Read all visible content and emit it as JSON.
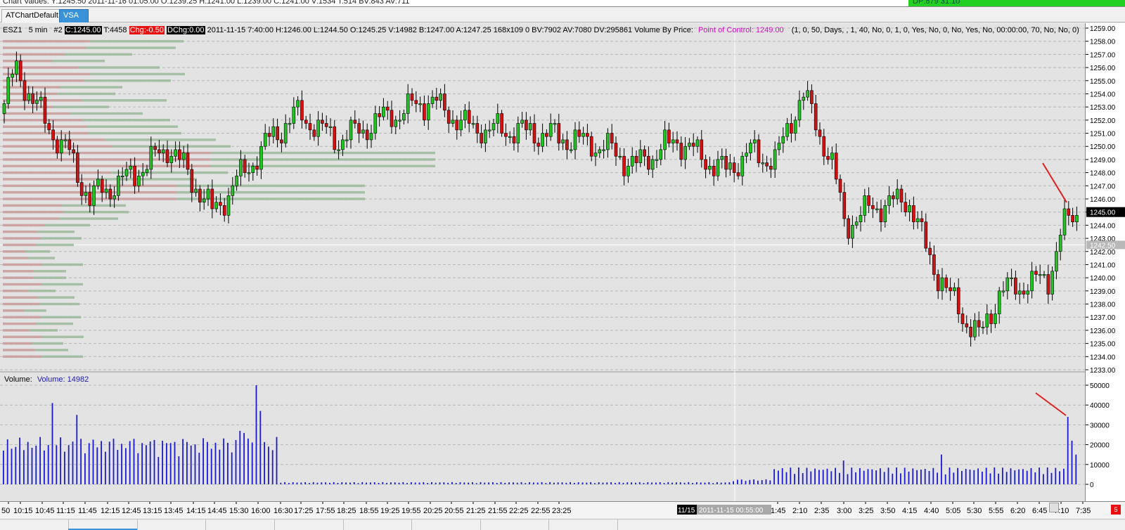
{
  "top_bar": {
    "chart_values": "Chart Values: Y:1245.50  2011-11-16  01:05:00  O:1239.25  H:1241.00  L:1239.00  C:1241.00  V:1534  T:514  BV:843  AV:711",
    "right_text": "DP:879  31:10",
    "right_color": "#22d022"
  },
  "tabs": [
    {
      "label": "ATChartDefault",
      "active": false
    },
    {
      "label": "VSA",
      "active": true
    }
  ],
  "info": {
    "symbol": "ESZ1",
    "interval": "5 min",
    "chart_num": "#2",
    "close": "C:1245.00",
    "ticks": "T:4458",
    "chg": "Chg:-0.50",
    "dchg": "DChg:0.00",
    "bar_stats": "2011-11-15 7:40:00 H:1246.00 L:1244.50 O:1245.25 V:14982 B:1247.00 A:1247.25 168x109 0 BV:7902 AV:7080 DV:295861 Volume By Price:",
    "poc": "Point of Control: 1249.00",
    "params": "(1, 0, 50, Days, , 1, 40, No, 0, 1, 0, Yes, No, 0, No, Yes, No, 00:00:00, 70, No, No, 0)"
  },
  "volume_panel": {
    "label": "Volume:",
    "value_label": "Volume: 14982"
  },
  "price_axis": {
    "ticks": [
      "1259.00",
      "1258.00",
      "1257.00",
      "1256.00",
      "1255.00",
      "1254.00",
      "1253.00",
      "1252.00",
      "1251.00",
      "1250.00",
      "1249.00",
      "1248.00",
      "1247.00",
      "1246.00",
      "1245.00",
      "1244.00",
      "1243.00",
      "1242.00",
      "1241.00",
      "1240.00",
      "1239.00",
      "1238.00",
      "1237.00",
      "1236.00",
      "1235.00",
      "1234.00",
      "1233.00"
    ],
    "last_price": "1245.00",
    "crosshair_price": "1242.50"
  },
  "volume_axis": {
    "ticks": [
      "50000",
      "40000",
      "30000",
      "20000",
      "10000",
      "0"
    ]
  },
  "time_axis": {
    "labels": [
      "50",
      "10:15",
      "10:45",
      "11:15",
      "11:45",
      "12:15",
      "12:45",
      "13:15",
      "13:45",
      "14:15",
      "14:45",
      "15:30",
      "16:00",
      "16:30",
      "17:25",
      "17:55",
      "18:25",
      "18:55",
      "19:25",
      "19:55",
      "20:25",
      "20:55",
      "21:25",
      "21:55",
      "22:25",
      "22:55",
      "23:25",
      "1:45",
      "2:10",
      "2:35",
      "3:00",
      "3:25",
      "3:50",
      "4:15",
      "4:40",
      "5:05",
      "5:30",
      "5:55",
      "6:20",
      "6:45",
      "7:10",
      "7:35"
    ],
    "date_tag": "11/15",
    "crosshair_time": "2011-11-15  00:55:00"
  },
  "footer": {
    "corner_badge": "5"
  },
  "colors": {
    "up_candle": "#22c422",
    "down_candle": "#d41010",
    "volume_bar": "#1a1ad0",
    "profile_up": "#9cb89c",
    "profile_down": "#c89a9a",
    "poc_text": "#d010c0",
    "annotation": "#e02020"
  },
  "chart_data": [
    {
      "type": "candlestick",
      "symbol": "ESZ1",
      "interval": "5 min",
      "ylim": [
        1233,
        1259
      ],
      "key_points": [
        {
          "time": "10:15",
          "high": 1257.5,
          "low": 1252.0
        },
        {
          "time": "11:15",
          "high": 1248.0,
          "low": 1244.5
        },
        {
          "time": "13:45",
          "high": 1246.5,
          "low": 1243.5
        },
        {
          "time": "16:00",
          "high": 1253.0,
          "low": 1251.0
        },
        {
          "time": "18:55",
          "high": 1254.0,
          "low": 1252.5
        },
        {
          "time": "22:25",
          "high": 1250.0,
          "low": 1247.5
        },
        {
          "time": "2:10",
          "high": 1254.8,
          "low": 1251.0
        },
        {
          "time": "3:00",
          "high": 1246.0,
          "low": 1242.0
        },
        {
          "time": "4:15",
          "high": 1247.0,
          "low": 1244.5
        },
        {
          "time": "5:30",
          "high": 1236.5,
          "low": 1234.0
        },
        {
          "time": "6:45",
          "high": 1240.5,
          "low": 1238.0
        },
        {
          "time": "7:35",
          "open": 1245.25,
          "high": 1246.0,
          "low": 1244.5,
          "close": 1245.0
        }
      ],
      "point_of_control": 1249.0,
      "last": 1245.0
    },
    {
      "type": "bar",
      "title": "Volume",
      "ylim": [
        0,
        50000
      ],
      "peaks": [
        {
          "time": "10:45",
          "value": 41000
        },
        {
          "time": "11:15",
          "value": 35000
        },
        {
          "time": "14:45",
          "value": 50000
        },
        {
          "time": "5:05",
          "value": 15000
        },
        {
          "time": "7:35",
          "value": 34000
        }
      ],
      "last_value": 14982
    }
  ]
}
